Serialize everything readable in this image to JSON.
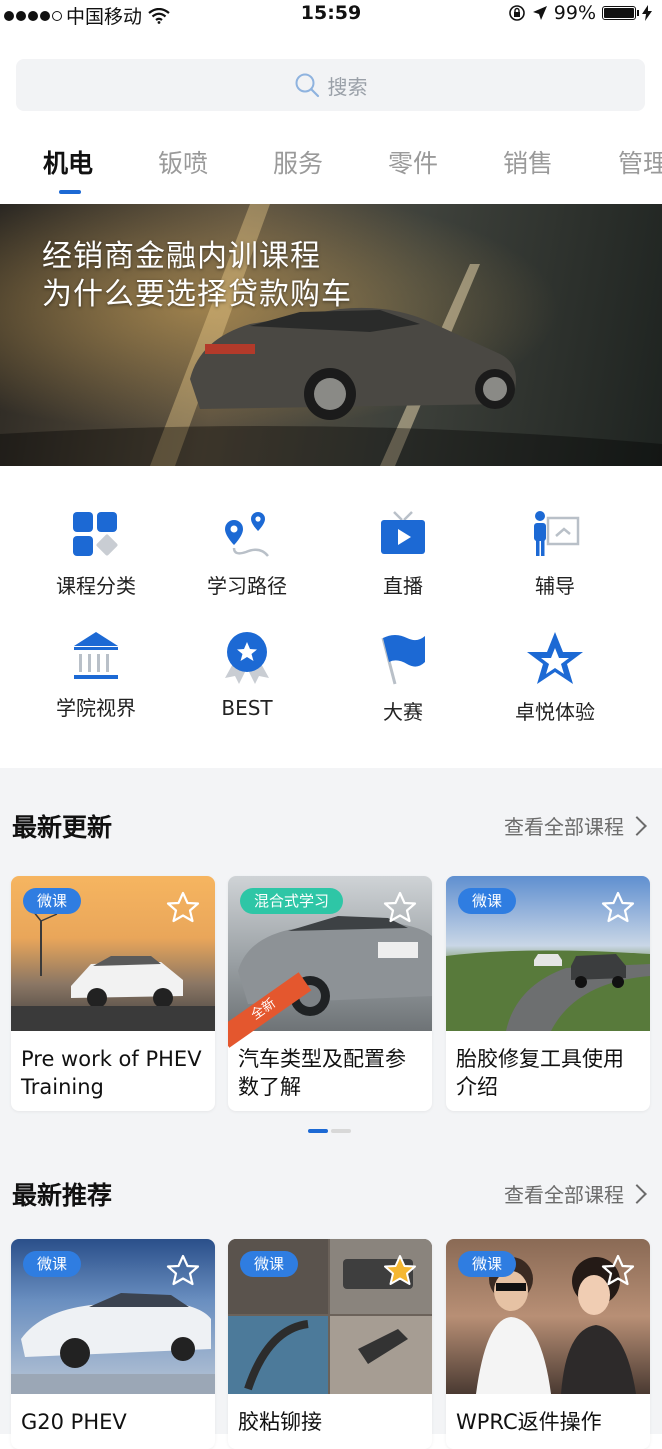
{
  "status_bar": {
    "carrier": "中国移动",
    "time": "15:59",
    "battery_percent": "99%",
    "battery_level": 0.99
  },
  "search": {
    "placeholder": "搜索"
  },
  "tabs": [
    {
      "label": "机电",
      "active": true
    },
    {
      "label": "钣喷",
      "active": false
    },
    {
      "label": "服务",
      "active": false
    },
    {
      "label": "零件",
      "active": false
    },
    {
      "label": "销售",
      "active": false
    },
    {
      "label": "管理",
      "active": false
    }
  ],
  "banner": {
    "line1": "经销商金融内训课程",
    "line2": "为什么要选择贷款购车"
  },
  "quick_menu": [
    {
      "label": "课程分类",
      "icon": "grid-apps-icon"
    },
    {
      "label": "学习路径",
      "icon": "route-pin-icon"
    },
    {
      "label": "直播",
      "icon": "tv-play-icon"
    },
    {
      "label": "辅导",
      "icon": "presenter-board-icon"
    },
    {
      "label": "学院视界",
      "icon": "academy-building-icon"
    },
    {
      "label": "BEST",
      "icon": "award-medal-icon"
    },
    {
      "label": "大赛",
      "icon": "flag-icon"
    },
    {
      "label": "卓悦体验",
      "icon": "star-badge-icon"
    }
  ],
  "latest_updates": {
    "title": "最新更新",
    "link": "查看全部课程",
    "cards": [
      {
        "tag": "微课",
        "title": "Pre work of PHEV Training",
        "starred": false
      },
      {
        "tag": "混合式学习",
        "title": "汽车类型及配置参数了解",
        "starred": false,
        "ribbon": "全新"
      },
      {
        "tag": "微课",
        "title": "胎胶修复工具使用介绍",
        "starred": false
      }
    ]
  },
  "latest_recommend": {
    "title": "最新推荐",
    "link": "查看全部课程",
    "cards": [
      {
        "tag": "微课",
        "title": "G20 PHEV",
        "starred": false
      },
      {
        "tag": "微课",
        "title": "胶粘铆接",
        "starred": true
      },
      {
        "tag": "微课",
        "title": "WPRC返件操作",
        "starred": false
      }
    ]
  },
  "colors": {
    "accent": "#1c69d4",
    "tag_blue": "#2f7de1",
    "tag_green": "#2ec6a6",
    "star_gold": "#f5b731"
  }
}
